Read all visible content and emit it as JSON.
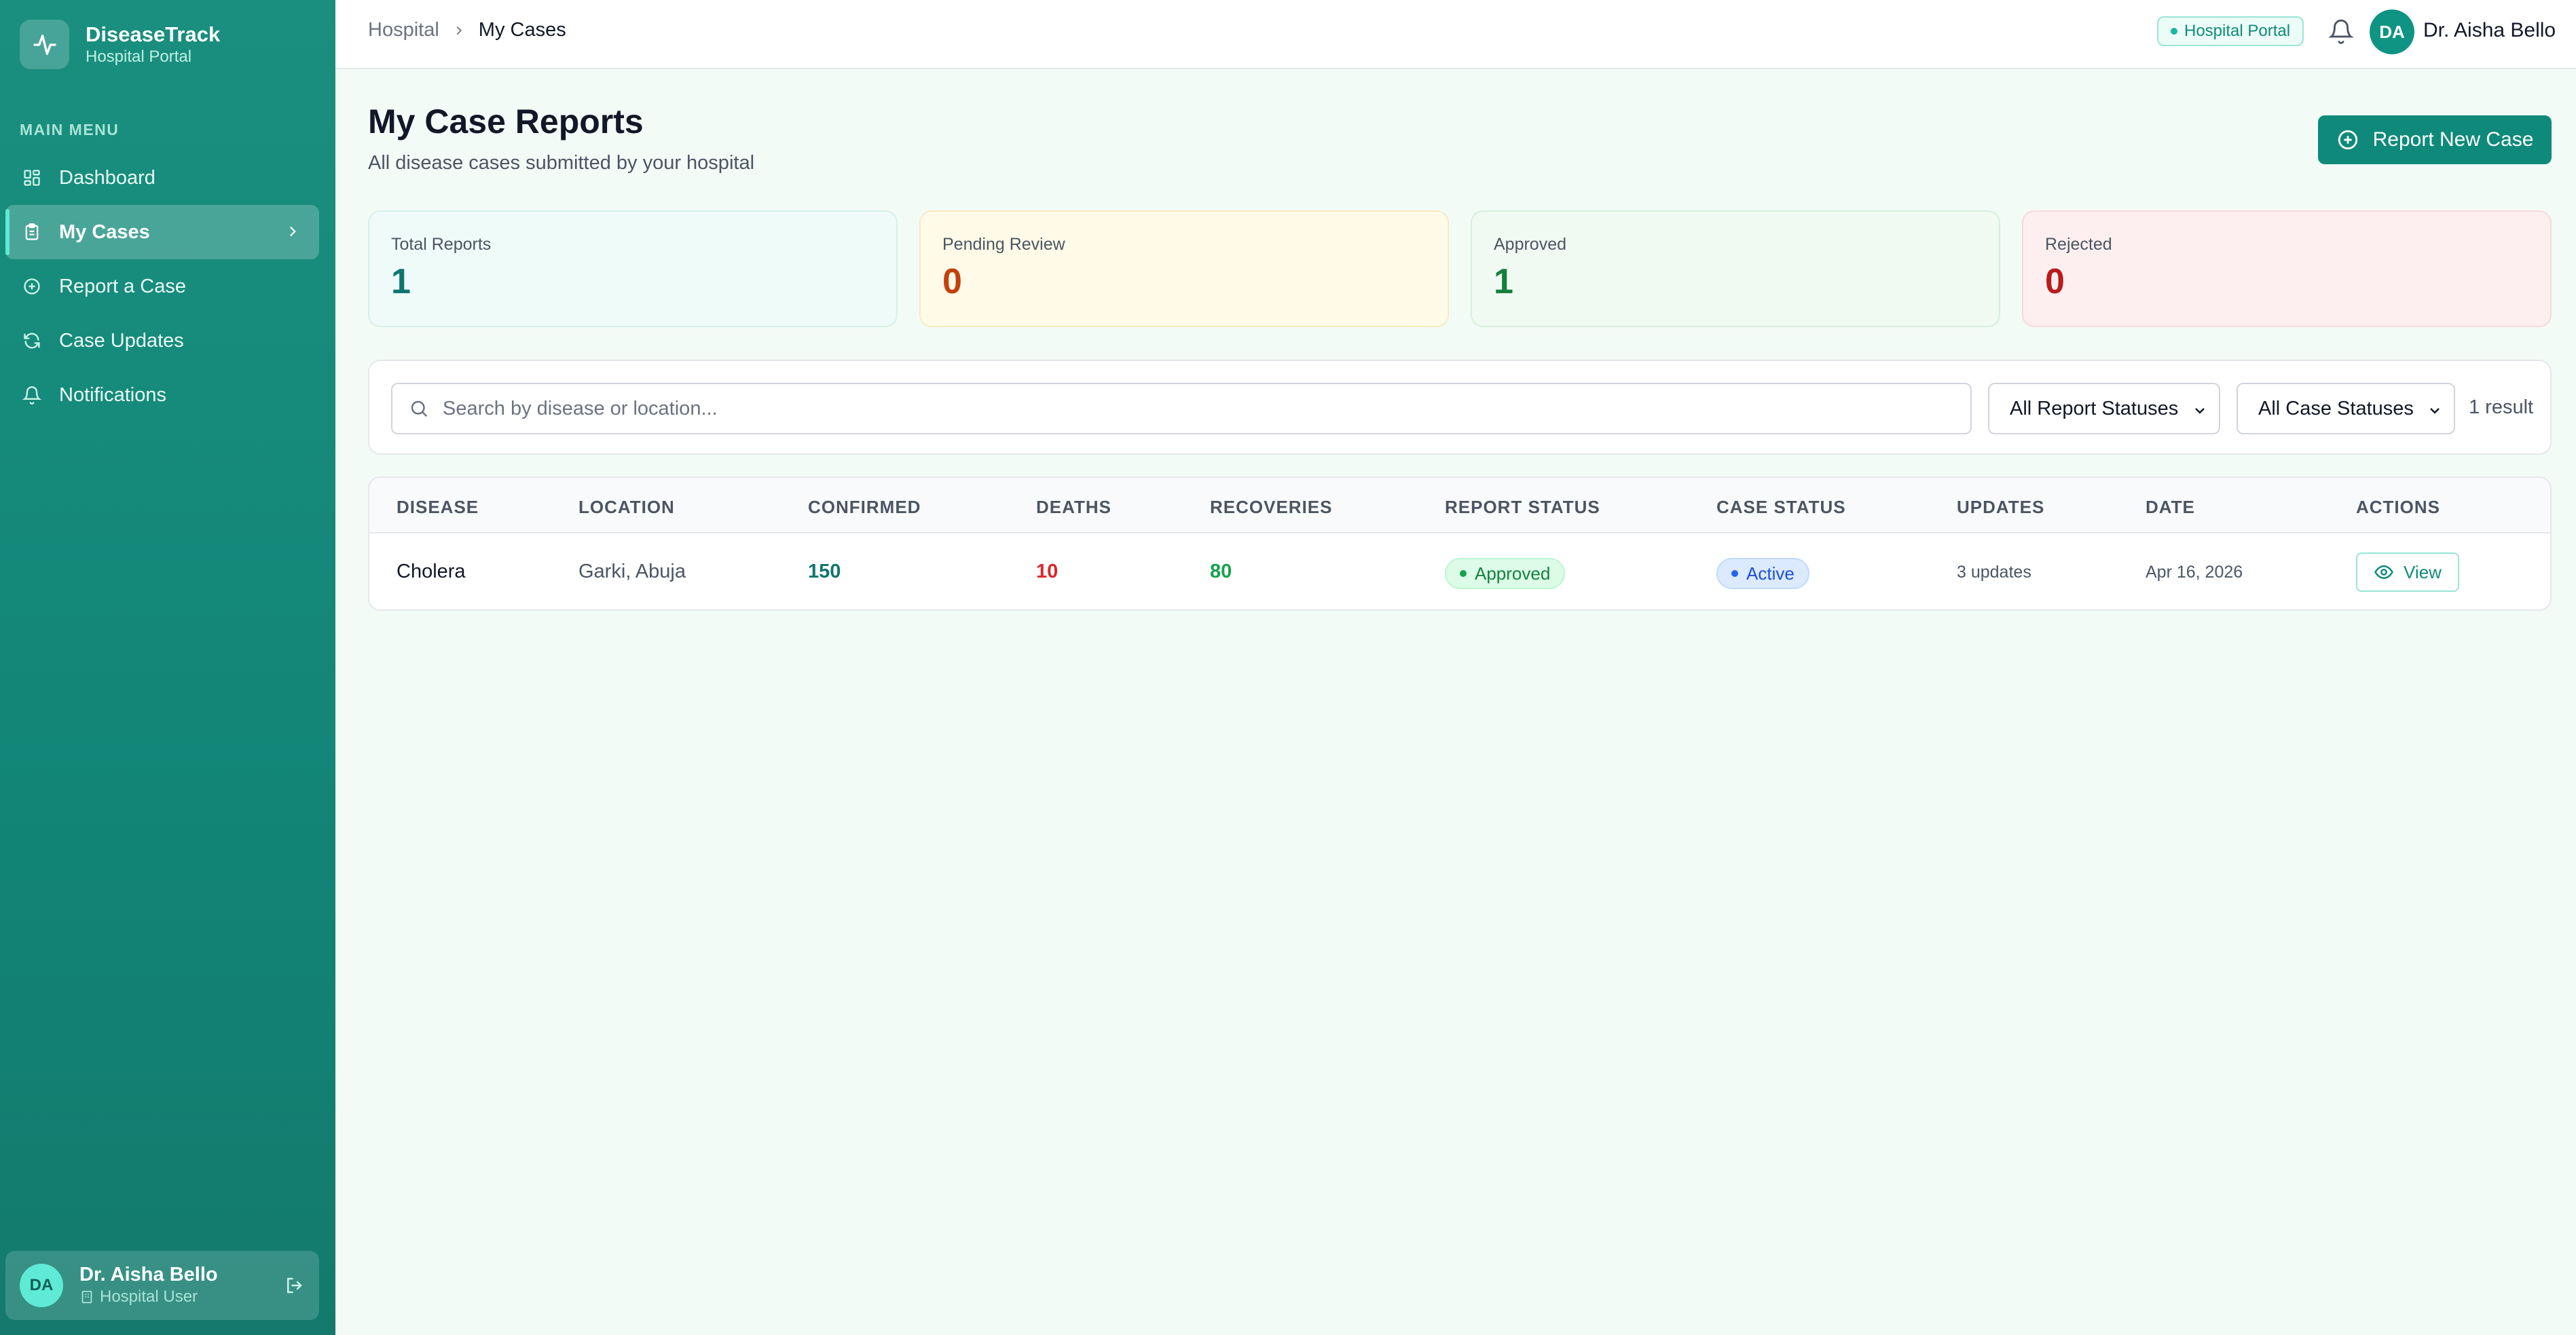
{
  "sidebar": {
    "brand_name": "DiseaseTrack",
    "brand_sub": "Hospital Portal",
    "menu_title": "MAIN MENU",
    "items": [
      {
        "label": "Dashboard",
        "icon": "grid-icon"
      },
      {
        "label": "My Cases",
        "icon": "clipboard-icon",
        "active": true
      },
      {
        "label": "Report a Case",
        "icon": "plus-circle-icon"
      },
      {
        "label": "Case Updates",
        "icon": "refresh-icon"
      },
      {
        "label": "Notifications",
        "icon": "bell-icon"
      }
    ],
    "user": {
      "initials": "DA",
      "name": "Dr. Aisha Bello",
      "role": "Hospital User"
    }
  },
  "topbar": {
    "breadcrumb_root": "Hospital",
    "breadcrumb_current": "My Cases",
    "portal_badge": "Hospital Portal",
    "user_initials": "DA",
    "user_name": "Dr. Aisha Bello"
  },
  "header": {
    "title": "My Case Reports",
    "subtitle": "All disease cases submitted by your hospital",
    "report_button": "Report New Case"
  },
  "stats": [
    {
      "label": "Total Reports",
      "value": "1",
      "color": "#0f766e"
    },
    {
      "label": "Pending Review",
      "value": "0",
      "color": "#c2410c"
    },
    {
      "label": "Approved",
      "value": "1",
      "color": "#15803d"
    },
    {
      "label": "Rejected",
      "value": "0",
      "color": "#b91c1c"
    }
  ],
  "filters": {
    "search_placeholder": "Search by disease or location...",
    "report_status": "All Report Statuses",
    "case_status": "All Case Statuses",
    "result_count": "1 result"
  },
  "table": {
    "columns": [
      "DISEASE",
      "LOCATION",
      "CONFIRMED",
      "DEATHS",
      "RECOVERIES",
      "REPORT STATUS",
      "CASE STATUS",
      "UPDATES",
      "DATE",
      "ACTIONS"
    ],
    "rows": [
      {
        "disease": "Cholera",
        "location": "Garki, Abuja",
        "confirmed": "150",
        "deaths": "10",
        "recoveries": "80",
        "report_status": "Approved",
        "case_status": "Active",
        "updates": "3 updates",
        "date": "Apr 16, 2026",
        "action": "View"
      }
    ]
  },
  "colors": {
    "brand": "#128577",
    "accent": "#0f8a7a"
  }
}
